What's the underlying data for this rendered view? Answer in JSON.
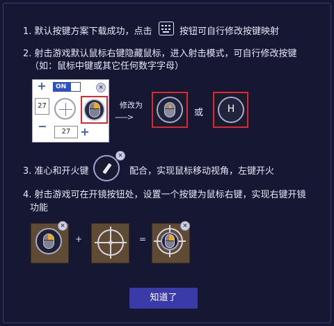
{
  "steps": {
    "s1a": "1. 默认按键方案下载成功，点击",
    "s1b": "按钮可自行修改按键映射",
    "s2a": "2. 射击游戏默认鼠标右键隐藏鼠标，进入射击模式，可自行修改按键",
    "s2b": "（如：鼠标中键或其它任何数字字母）",
    "s3a": "3. 准心和开火键",
    "s3b": "配合，实现鼠标移动视角，左键开火",
    "s4a": "4. 射击游戏可在开镜按钮处，设置一个按键为鼠标右键，实现右键开镜",
    "s4b": "功能"
  },
  "demo": {
    "plus": "+",
    "minus": "−",
    "toggle_label": "ON",
    "value_left": "27",
    "value_bottom": "27",
    "close": "×"
  },
  "arrow_label": "修改为",
  "arrow_glyph": "------>",
  "or_label": "或",
  "key_h": "H",
  "equation": {
    "plus": "+",
    "equals": "="
  },
  "confirm_button": "知道了",
  "colors": {
    "background": "#161733",
    "accent_red": "#e0262e",
    "button": "#3a3aa8",
    "mouse_highlight": "#f0a818"
  },
  "icons": [
    "keyboard-icon",
    "mouse-icon",
    "crosshair-icon",
    "fire-key-icon",
    "close-icon"
  ]
}
